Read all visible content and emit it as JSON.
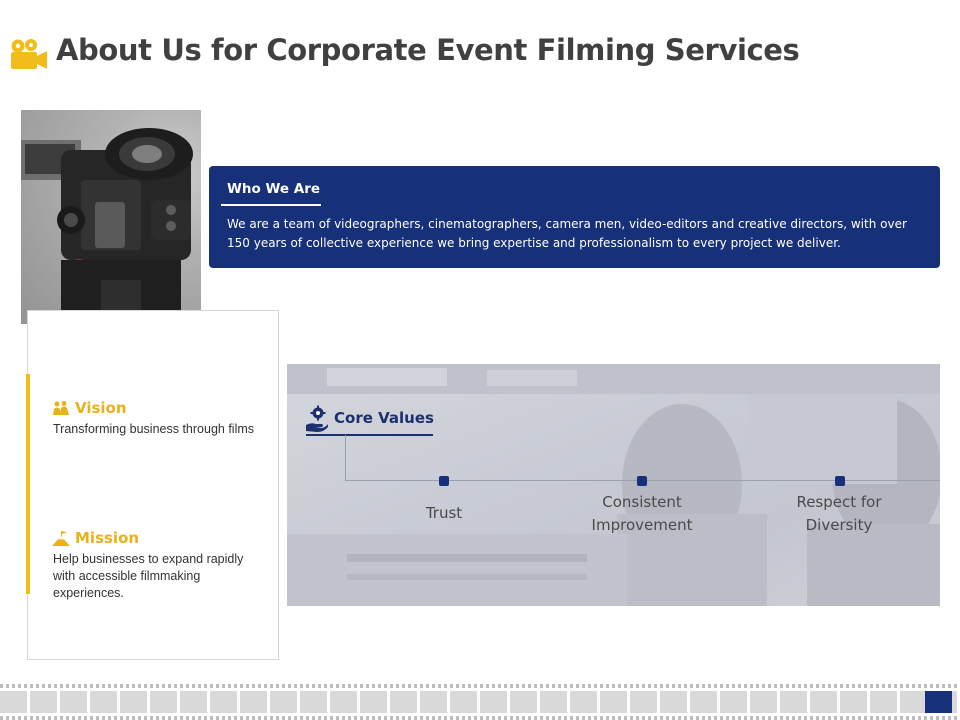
{
  "page": {
    "title": "About Us for Corporate Event Filming Services",
    "title_icon": "video-camera-icon"
  },
  "colors": {
    "accent_yellow": "#f2bd1a",
    "navy": "#16307a",
    "title_gray": "#404040"
  },
  "who_we_are": {
    "heading": "Who We Are",
    "body": "We are a team of videographers, cinematographers, camera men, video-editors and creative directors, with over 150 years of collective experience we bring expertise and professionalism to every project we deliver."
  },
  "vision": {
    "icon": "vision-people-icon",
    "heading": "Vision",
    "body": "Transforming business through films"
  },
  "mission": {
    "icon": "mountain-flag-icon",
    "heading": "Mission",
    "body": "Help businesses to expand rapidly with accessible filmmaking experiences."
  },
  "core_values": {
    "icon": "hand-gear-icon",
    "heading": "Core Values",
    "items": [
      {
        "line1": "Trust",
        "line2": ""
      },
      {
        "line1": "Consistent",
        "line2": "Improvement"
      },
      {
        "line1": "Respect for",
        "line2": "Diversity"
      }
    ]
  },
  "images": {
    "camera_photo": "professional-video-camera-photo",
    "core_values_background": "control-room-photo"
  }
}
